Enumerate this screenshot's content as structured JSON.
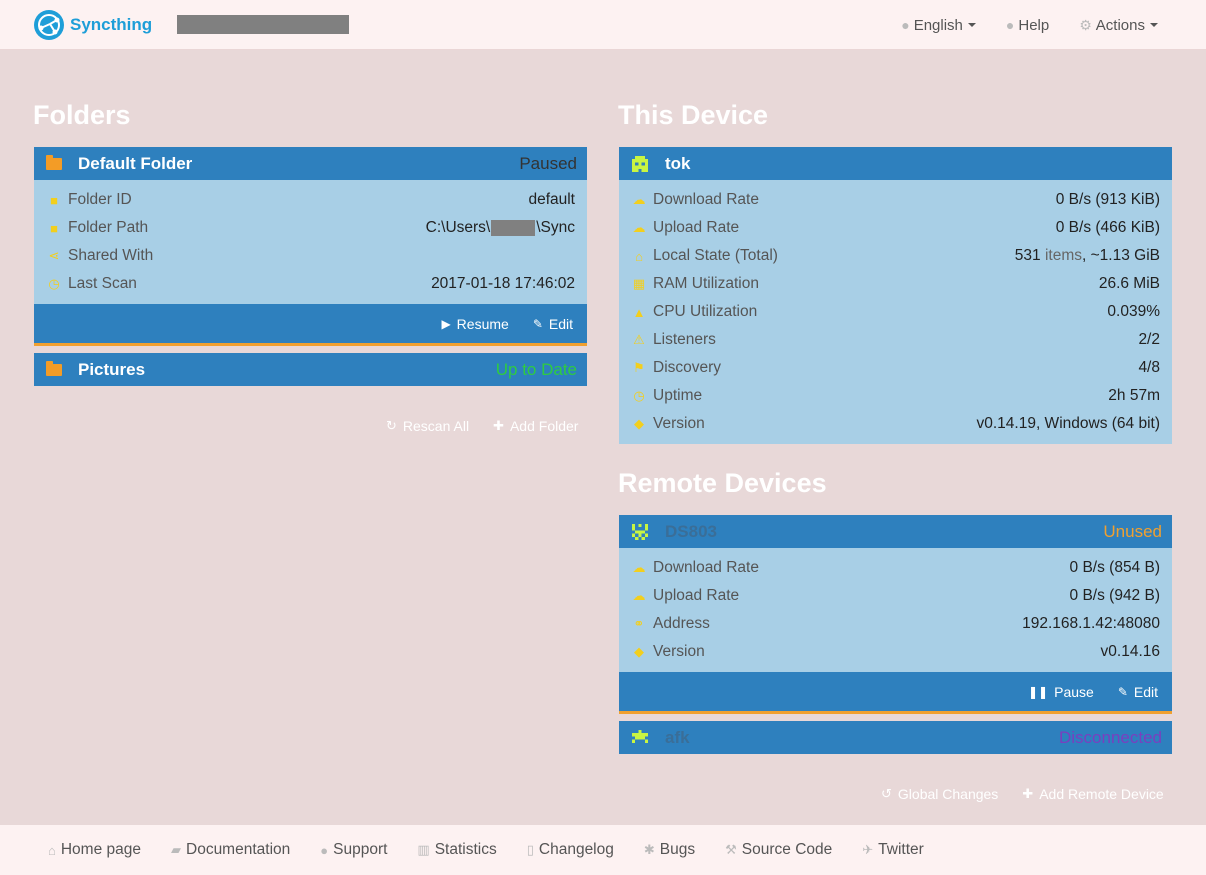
{
  "navbar": {
    "brand": "Syncthing",
    "language": "English",
    "help": "Help",
    "actions": "Actions"
  },
  "folders": {
    "heading": "Folders",
    "items": [
      {
        "name": "Default Folder",
        "status": "Paused",
        "details": {
          "folder_id_label": "Folder ID",
          "folder_id": "default",
          "folder_path_label": "Folder Path",
          "folder_path_prefix": "C:\\Users\\",
          "folder_path_suffix": "\\Sync",
          "shared_with_label": "Shared With",
          "last_scan_label": "Last Scan",
          "last_scan": "2017-01-18 17:46:02"
        },
        "resume": "Resume",
        "edit": "Edit"
      },
      {
        "name": "Pictures",
        "status": "Up to Date"
      }
    ],
    "rescan_all": "Rescan All",
    "add_folder": "Add Folder"
  },
  "this_device": {
    "heading": "This Device",
    "name": "tok",
    "rows": [
      {
        "label": "Download Rate",
        "value": "0 B/s (913 KiB)"
      },
      {
        "label": "Upload Rate",
        "value": "0 B/s (466 KiB)"
      },
      {
        "label": "Local State (Total)",
        "value_num": "531",
        "value_unit": "items",
        "value_rest": ", ~1.13 GiB"
      },
      {
        "label": "RAM Utilization",
        "value": "26.6 MiB"
      },
      {
        "label": "CPU Utilization",
        "value": "0.039%"
      },
      {
        "label": "Listeners",
        "value": "2/2"
      },
      {
        "label": "Discovery",
        "value": "4/8"
      },
      {
        "label": "Uptime",
        "value": "2h 57m"
      },
      {
        "label": "Version",
        "value": "v0.14.19, Windows (64 bit)"
      }
    ]
  },
  "remote_devices": {
    "heading": "Remote Devices",
    "items": [
      {
        "name": "DS803",
        "status": "Unused",
        "rows": [
          {
            "label": "Download Rate",
            "value": "0 B/s (854 B)"
          },
          {
            "label": "Upload Rate",
            "value": "0 B/s (942 B)"
          },
          {
            "label": "Address",
            "value": "192.168.1.42:48080"
          },
          {
            "label": "Version",
            "value": "v0.14.16"
          }
        ],
        "pause": "Pause",
        "edit": "Edit"
      },
      {
        "name": "afk",
        "status": "Disconnected"
      }
    ],
    "global_changes": "Global Changes",
    "add_remote_device": "Add Remote Device"
  },
  "footer": {
    "links": [
      "Home page",
      "Documentation",
      "Support",
      "Statistics",
      "Changelog",
      "Bugs",
      "Source Code",
      "Twitter"
    ]
  },
  "colors": {
    "panel_header": "#2e80be",
    "panel_body": "#a8cfe6",
    "status_paused": "#333333",
    "status_up_to_date": "#2ecc40",
    "status_unused": "#f0a030",
    "status_disconnected": "#7a3fbf",
    "icon_yellow": "#f2cf1e",
    "folder_orange": "#f39c26"
  },
  "icons": [
    "logo-icon",
    "globe-icon",
    "question-icon",
    "gear-icon",
    "folder-icon",
    "device-identicon",
    "refresh-icon",
    "plus-icon",
    "play-icon",
    "pencil-icon",
    "pause-icon",
    "history-icon",
    "home-icon",
    "book-icon",
    "support-icon",
    "chart-icon",
    "file-icon",
    "bug-icon",
    "wrench-icon",
    "twitter-icon"
  ]
}
